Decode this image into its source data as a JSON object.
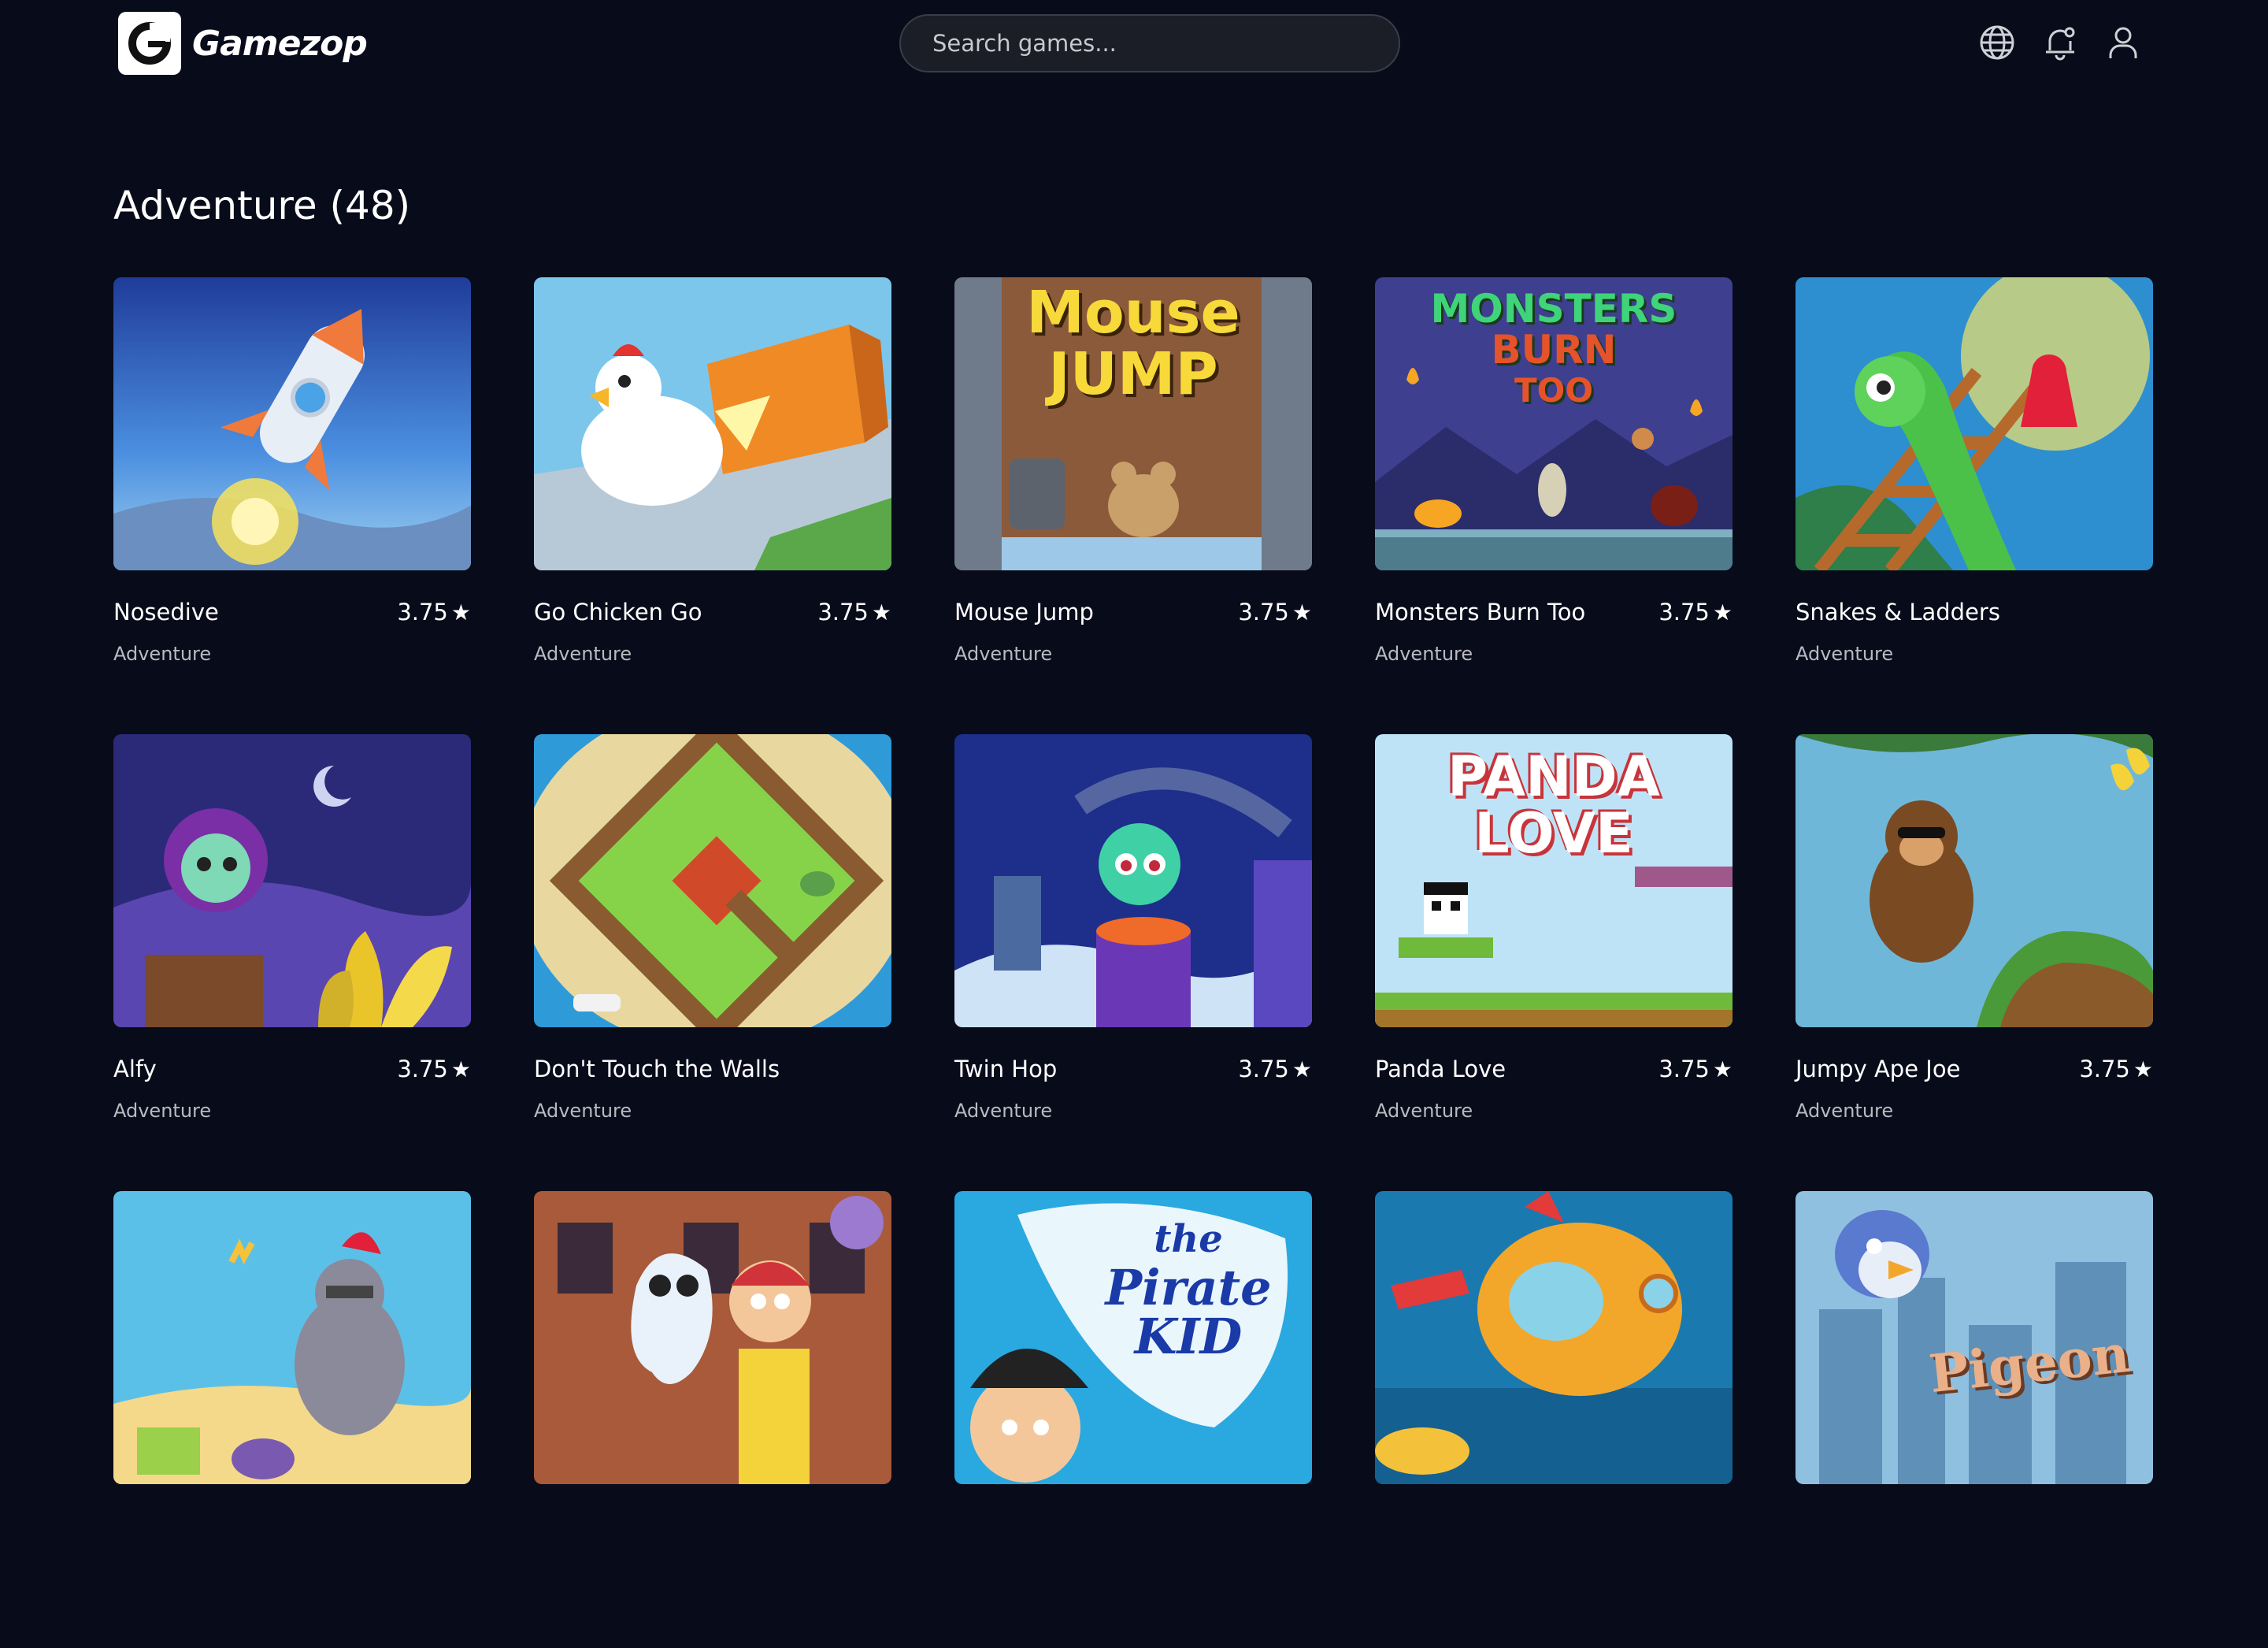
{
  "header": {
    "logo_text": "Gamezop",
    "search_placeholder": "Search games...",
    "icons": [
      "globe-icon",
      "notification-bell-icon",
      "user-profile-icon"
    ]
  },
  "page": {
    "title": "Adventure (48)"
  },
  "games": [
    {
      "name": "Nosedive",
      "rating": "3.75",
      "genre": "Adventure"
    },
    {
      "name": "Go Chicken Go",
      "rating": "3.75",
      "genre": "Adventure"
    },
    {
      "name": "Mouse Jump",
      "rating": "3.75",
      "genre": "Adventure",
      "thumb_text": [
        "Mouse",
        "JUMP"
      ]
    },
    {
      "name": "Monsters Burn Too",
      "rating": "3.75",
      "genre": "Adventure",
      "thumb_text": [
        "MONSTERS",
        "BURN",
        "TOO"
      ]
    },
    {
      "name": "Snakes & Ladders",
      "rating": "",
      "genre": "Adventure"
    },
    {
      "name": "Alfy",
      "rating": "3.75",
      "genre": "Adventure"
    },
    {
      "name": "Don't Touch the Walls",
      "rating": "",
      "genre": "Adventure"
    },
    {
      "name": "Twin Hop",
      "rating": "3.75",
      "genre": "Adventure"
    },
    {
      "name": "Panda Love",
      "rating": "3.75",
      "genre": "Adventure",
      "thumb_text": [
        "PANDA",
        "LOVE"
      ]
    },
    {
      "name": "Jumpy Ape Joe",
      "rating": "3.75",
      "genre": "Adventure"
    },
    {
      "name": "",
      "rating": "",
      "genre": ""
    },
    {
      "name": "",
      "rating": "",
      "genre": ""
    },
    {
      "name": "",
      "rating": "",
      "genre": "",
      "thumb_text": [
        "the",
        "Pirate",
        "KID"
      ]
    },
    {
      "name": "",
      "rating": "",
      "genre": ""
    },
    {
      "name": "",
      "rating": "",
      "genre": "",
      "thumb_text": [
        "Pigeon"
      ]
    }
  ],
  "rating_icon": "star-icon"
}
